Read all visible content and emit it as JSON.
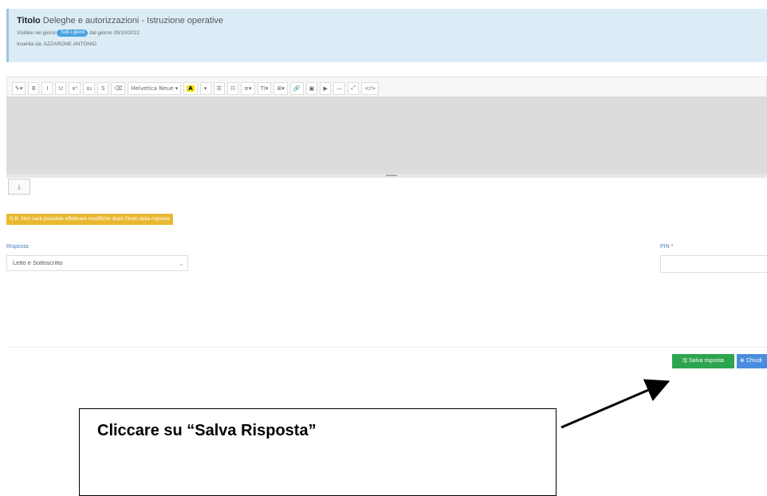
{
  "info": {
    "title_prefix": "Titolo",
    "title_text": "Deleghe e autorizzazioni - Istruzione operative",
    "visible_prefix": "Visibile nei giorni",
    "visible_badge": "Tutti i giorni",
    "visible_suffix": "dal giorno 09/10/2022",
    "inserted_by": "Inserita da: AZZARONE ANTONIO"
  },
  "toolbar": {
    "items": [
      "✎▾",
      "B",
      "I",
      "U",
      "x²",
      "x₂",
      "S",
      "⌫",
      "Helvetica Neue ▾",
      "A",
      "▾",
      "☰",
      "☷",
      "≡▾",
      "TI▾",
      "⊞▾",
      "🔗",
      "▣",
      "▶",
      "—",
      "⤢",
      "</>"
    ]
  },
  "upload_icon": "⤓",
  "warning": "N.B. Non sarà possibile effettuare modifiche dopo l'invio della risposta",
  "risposta": {
    "label": "Risposta:",
    "value": "Letto e Sottoscritto"
  },
  "pin": {
    "label": "PIN",
    "required_mark": "*"
  },
  "buttons": {
    "save": "Salva risposta",
    "close": "Chiudi"
  },
  "callout": {
    "text": "Cliccare su “Salva Risposta”"
  }
}
